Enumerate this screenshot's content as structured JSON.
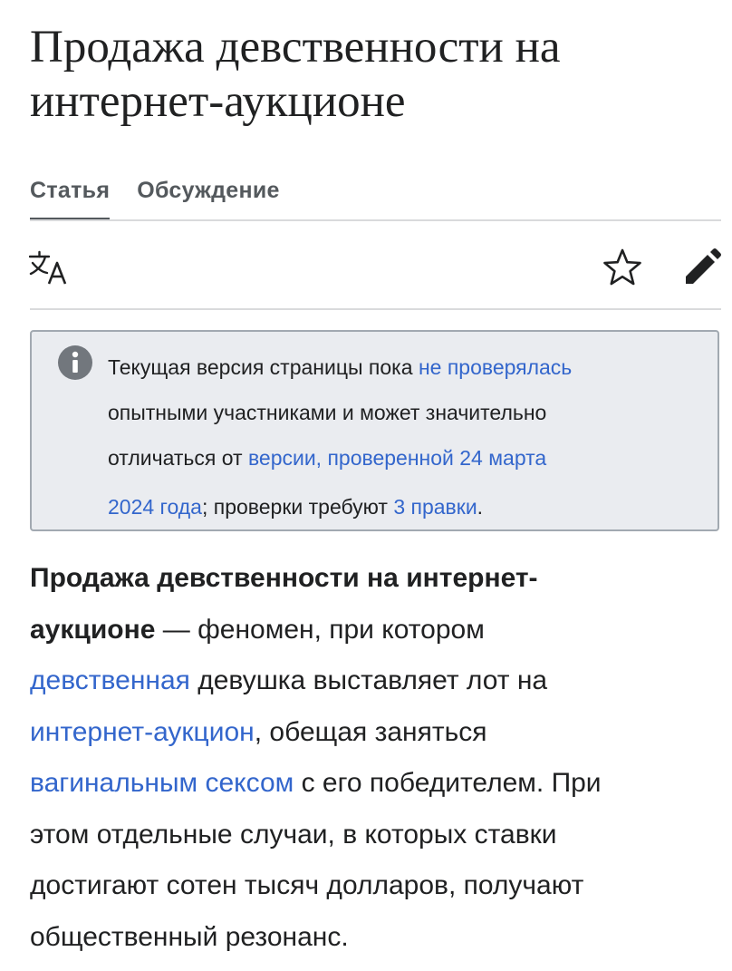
{
  "article": {
    "title_line1": "Продажа девственности на",
    "title_line2": "интернет-аукционе"
  },
  "tabs": [
    {
      "label": "Статья",
      "active": true
    },
    {
      "label": "Обсуждение",
      "active": false
    }
  ],
  "toolbar": {
    "icons": [
      "language-icon",
      "star-icon",
      "edit-pencil-icon"
    ]
  },
  "notice": {
    "icon": "info-icon",
    "line1_text": "Текущая версия страницы пока ",
    "line1_link": "не проверялась",
    "line2_text": "опытными участниками и может значительно",
    "line3_text": "отличаться от ",
    "line3_link": "версии, проверенной 24 марта",
    "line4_link": "2024 года",
    "line4_text": "; проверки требуют ",
    "line4_link2": "3 правки",
    "line4_end": "."
  },
  "lead": {
    "line1_bold": "Продажа девственности на интернет-",
    "line2_bold": "аукционе",
    "line2_text": " — феномен, при котором",
    "line3_link": "девственная",
    "line3_text": " девушка выставляет лот на",
    "line4_link": "интернет-аукцион",
    "line4_text": ", обещая заняться",
    "line5_link": "вагинальным сексом",
    "line5_text": " с его победителем. При",
    "line6_text": "этом отдельные случаи, в которых ставки",
    "line7_text": "достигают сотен тысяч долларов, получают",
    "line8_text": "общественный резонанс."
  },
  "colors": {
    "link": "#3366cc",
    "text": "#202122",
    "notice_bg": "#eaecf0",
    "notice_border": "#a2a9b1",
    "icon_gray": "#72777d"
  }
}
